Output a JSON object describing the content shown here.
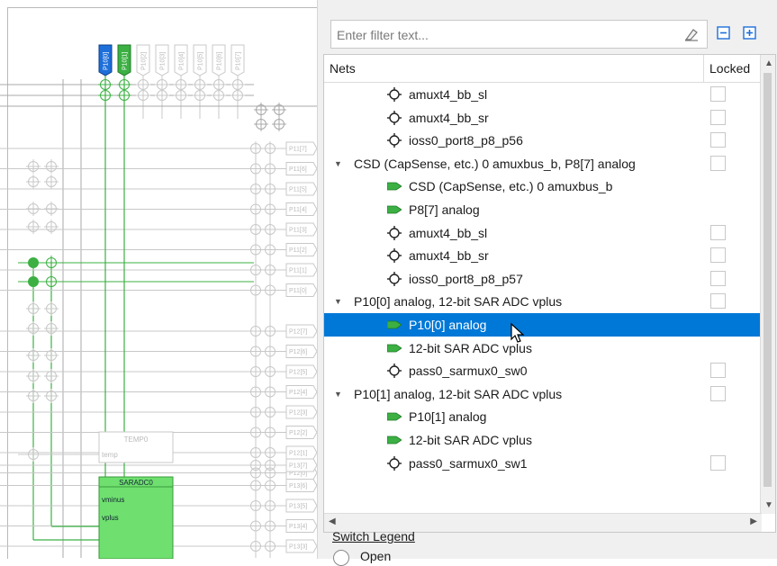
{
  "schematic": {
    "pins_top": [
      "P10[0]",
      "P10[1]",
      "P10[2]",
      "P10[3]",
      "P10[4]",
      "P10[5]",
      "P10[6]",
      "P10[7]"
    ],
    "pins_right_upper": [
      "P11[7]",
      "P11[6]",
      "P11[5]",
      "P11[4]",
      "P11[3]",
      "P11[2]",
      "P11[1]",
      "P11[0]"
    ],
    "pins_right_middle": [
      "P12[7]",
      "P12[6]",
      "P12[5]",
      "P12[4]",
      "P12[3]",
      "P12[2]",
      "P12[1]",
      "P12[0]"
    ],
    "pins_right_lower": [
      "P13[7]",
      "P13[6]",
      "P13[5]",
      "P13[4]",
      "P13[3]"
    ],
    "temp_block": {
      "title": "TEMP0",
      "port": "temp"
    },
    "sar_block": {
      "title": "SARADC0",
      "ports": [
        "vminus",
        "vplus"
      ]
    }
  },
  "panel": {
    "filter_placeholder": "Enter filter text...",
    "col_nets": "Nets",
    "col_locked": "Locked",
    "rows": [
      {
        "text": "amuxt4_bb_sl",
        "icon": "switch-icon",
        "checkbox": true
      },
      {
        "text": "amuxt4_bb_sr",
        "icon": "switch-icon",
        "checkbox": true
      },
      {
        "text": "ioss0_port8_p8_p56",
        "icon": "switch-icon",
        "checkbox": true
      },
      {
        "text": "CSD (CapSense, etc.) 0 amuxbus_b, P8[7] analog",
        "icon": "expand-arrow",
        "checkbox": true
      },
      {
        "text": "CSD (CapSense, etc.) 0 amuxbus_b",
        "icon": "terminal-icon",
        "checkbox": false
      },
      {
        "text": "P8[7] analog",
        "icon": "terminal-icon",
        "checkbox": false
      },
      {
        "text": "amuxt4_bb_sl",
        "icon": "switch-icon",
        "checkbox": true
      },
      {
        "text": "amuxt4_bb_sr",
        "icon": "switch-icon",
        "checkbox": true
      },
      {
        "text": "ioss0_port8_p8_p57",
        "icon": "switch-icon",
        "checkbox": true
      },
      {
        "text": "P10[0] analog, 12-bit SAR ADC vplus",
        "icon": "expand-arrow",
        "checkbox": true
      },
      {
        "text": "P10[0] analog",
        "icon": "terminal-icon",
        "checkbox": false,
        "selected": true
      },
      {
        "text": "12-bit SAR ADC vplus",
        "icon": "terminal-icon",
        "checkbox": false
      },
      {
        "text": "pass0_sarmux0_sw0",
        "icon": "switch-icon",
        "checkbox": true
      },
      {
        "text": "P10[1] analog, 12-bit SAR ADC vplus",
        "icon": "expand-arrow",
        "checkbox": true
      },
      {
        "text": "P10[1] analog",
        "icon": "terminal-icon",
        "checkbox": false
      },
      {
        "text": "12-bit SAR ADC vplus",
        "icon": "terminal-icon",
        "checkbox": false
      },
      {
        "text": "pass0_sarmux0_sw1",
        "icon": "switch-icon",
        "checkbox": true
      }
    ],
    "legend_title": "Switch Legend",
    "legend_open": "Open"
  },
  "colors": {
    "accent": "#0078d7",
    "net_green": "#3cb043",
    "pin_blue": "#1e6fd9",
    "block_green": "#6fe06f"
  }
}
